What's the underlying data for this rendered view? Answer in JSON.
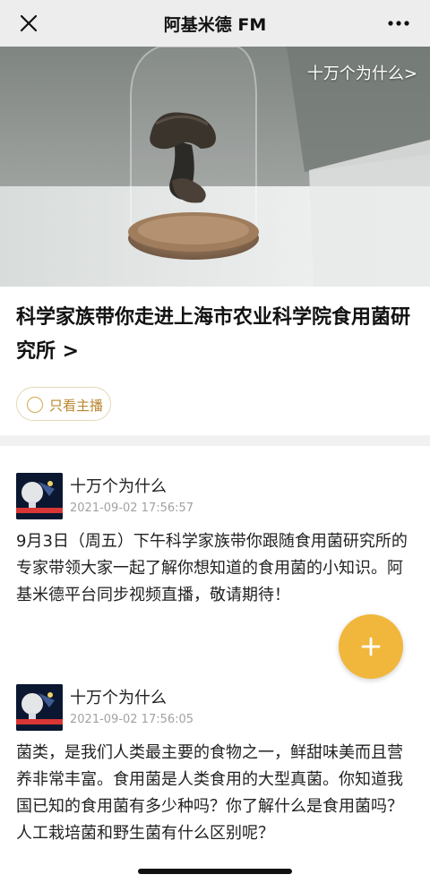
{
  "topbar": {
    "title": "阿基米德 FM",
    "close_icon": "close-icon",
    "more_icon": "more-icon"
  },
  "hero": {
    "tag_label": "十万个为什么>",
    "image_subject": "preserved mushroom specimen under glass dome"
  },
  "headline": "科学家族带你走进上海市农业科学院食用菌研究所 >",
  "filter": {
    "label": "只看主播",
    "icon": "radio-icon",
    "accent": "#d1a84f"
  },
  "posts": [
    {
      "author": "十万个为什么",
      "time": "2021-09-02 17:56:57",
      "text": "9月3日（周五）下午科学家族带你跟随食用菌研究所的专家带领大家一起了解你想知道的食用菌的小知识。阿基米德平台同步视频直播，敬请期待！"
    },
    {
      "author": "十万个为什么",
      "time": "2021-09-02 17:56:05",
      "text": "菌类，是我们人类最主要的食物之一，鲜甜味美而且营养非常丰富。食用菌是人类食用的大型真菌。你知道我国已知的食用菌有多少种吗？你了解什么是食用菌吗？人工栽培菌和野生菌有什么区别呢？"
    }
  ],
  "fab": {
    "icon": "plus-icon",
    "color": "#f0b73c"
  }
}
